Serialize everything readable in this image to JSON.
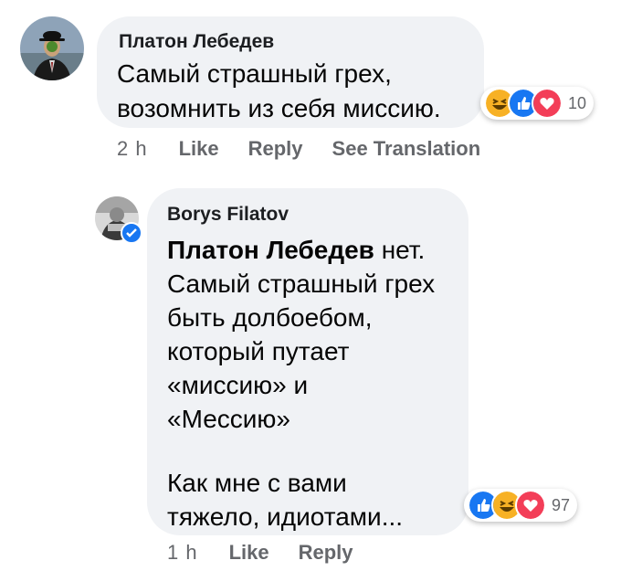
{
  "comment1": {
    "author": "Платон Лебедев",
    "lines": [
      "Самый страшный грех,",
      "возомнить из себя миссию."
    ],
    "reactions": {
      "icons": [
        "haha-icon",
        "like-icon",
        "love-icon"
      ],
      "count": "10"
    },
    "actions": {
      "time": "2 h",
      "like": "Like",
      "reply": "Reply",
      "translate": "See Translation"
    }
  },
  "reply1": {
    "author": "Borys Filatov",
    "mention": "Платон Лебедев",
    "lines": [
      "нет.",
      "Самый страшный грех",
      "быть долбоебом,",
      "который путает",
      "«миссию» и",
      "«Мессию»",
      "",
      "Как мне с вами",
      "тяжело, идиотами..."
    ],
    "reactions": {
      "icons": [
        "like-icon",
        "haha-icon",
        "love-icon"
      ],
      "count": "97"
    },
    "actions": {
      "time": "1 h",
      "like": "Like",
      "reply": "Reply"
    }
  },
  "colors": {
    "like": "#1877f2",
    "love": "#f33e58",
    "haha": "#f7b125",
    "verified": "#1877f2",
    "bubble": "#f0f2f5"
  }
}
